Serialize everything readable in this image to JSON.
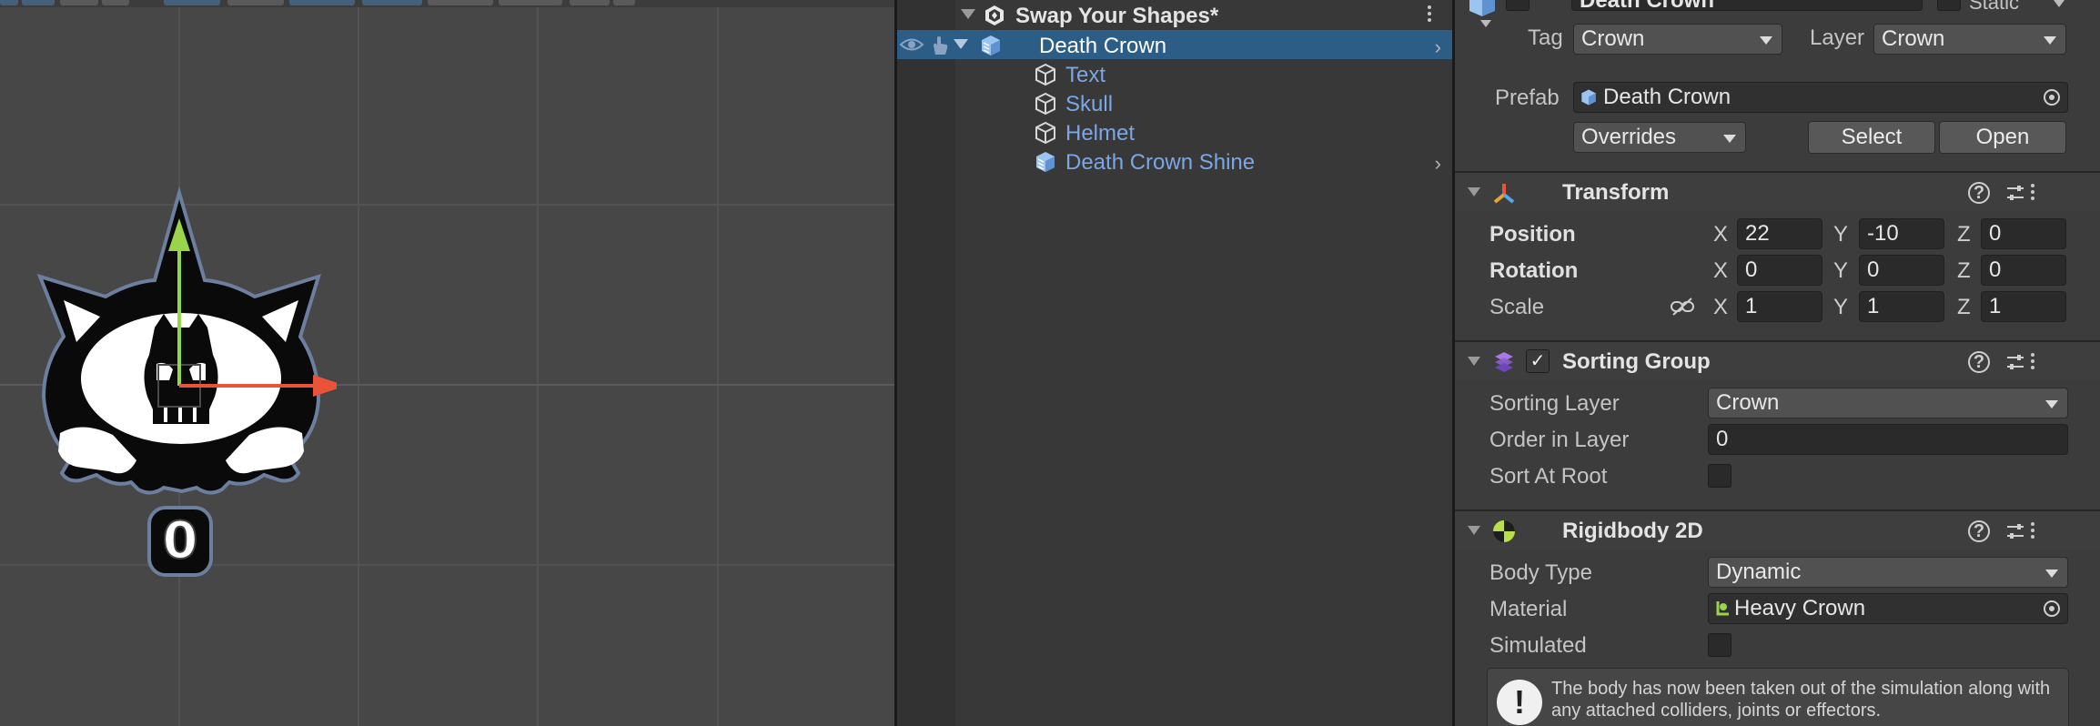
{
  "hierarchy": {
    "scene_name": "Swap Your Shapes*",
    "items": [
      {
        "label": "Death Crown",
        "selected": true
      },
      {
        "label": "Text"
      },
      {
        "label": "Skull"
      },
      {
        "label": "Helmet"
      },
      {
        "label": "Death Crown Shine"
      }
    ]
  },
  "scene": {
    "crown_counter": "0"
  },
  "inspector": {
    "object_name": "Death Crown",
    "static_label": "Static",
    "tag_label": "Tag",
    "tag_value": "Crown",
    "layer_label": "Layer",
    "layer_value": "Crown",
    "prefab_label": "Prefab",
    "prefab_value": "Death Crown",
    "overrides_label": "Overrides",
    "select_label": "Select",
    "open_label": "Open",
    "transform": {
      "title": "Transform",
      "position_label": "Position",
      "rotation_label": "Rotation",
      "scale_label": "Scale",
      "x_label": "X",
      "y_label": "Y",
      "z_label": "Z",
      "position": {
        "x": "22",
        "y": "-10",
        "z": "0"
      },
      "rotation": {
        "x": "0",
        "y": "0",
        "z": "0"
      },
      "scale": {
        "x": "1",
        "y": "1",
        "z": "1"
      }
    },
    "sorting_group": {
      "title": "Sorting Group",
      "sorting_layer_label": "Sorting Layer",
      "sorting_layer_value": "Crown",
      "order_label": "Order in Layer",
      "order_value": "0",
      "sort_at_root_label": "Sort At Root"
    },
    "rigidbody": {
      "title": "Rigidbody 2D",
      "body_type_label": "Body Type",
      "body_type_value": "Dynamic",
      "material_label": "Material",
      "material_value": "Heavy Crown",
      "simulated_label": "Simulated",
      "help_text": "The body has now been taken out of the simulation along with any attached colliders, joints or effectors."
    }
  },
  "colors": {
    "selection": "#2c5d87",
    "prefab_text": "#7ba7e6",
    "gizmo_x": "#e8533a",
    "gizmo_y": "#9ad44a"
  }
}
